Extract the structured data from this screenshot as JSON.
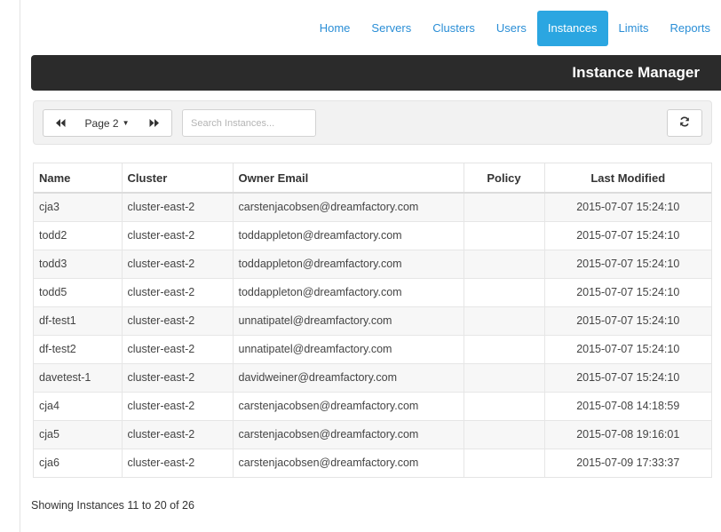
{
  "nav": {
    "items": [
      {
        "label": "Home",
        "active": false
      },
      {
        "label": "Servers",
        "active": false
      },
      {
        "label": "Clusters",
        "active": false
      },
      {
        "label": "Users",
        "active": false
      },
      {
        "label": "Instances",
        "active": true
      },
      {
        "label": "Limits",
        "active": false
      },
      {
        "label": "Reports",
        "active": false
      }
    ]
  },
  "header": {
    "title": "Instance Manager"
  },
  "toolbar": {
    "prev_icon": "fast-backward-icon",
    "page_label": "Page 2",
    "next_icon": "fast-forward-icon",
    "search_placeholder": "Search Instances...",
    "refresh_icon": "refresh-icon"
  },
  "table": {
    "columns": [
      "Name",
      "Cluster",
      "Owner Email",
      "Policy",
      "Last Modified"
    ],
    "rows": [
      [
        "cja3",
        "cluster-east-2",
        "carstenjacobsen@dreamfactory.com",
        "",
        "2015-07-07 15:24:10"
      ],
      [
        "todd2",
        "cluster-east-2",
        "toddappleton@dreamfactory.com",
        "",
        "2015-07-07 15:24:10"
      ],
      [
        "todd3",
        "cluster-east-2",
        "toddappleton@dreamfactory.com",
        "",
        "2015-07-07 15:24:10"
      ],
      [
        "todd5",
        "cluster-east-2",
        "toddappleton@dreamfactory.com",
        "",
        "2015-07-07 15:24:10"
      ],
      [
        "df-test1",
        "cluster-east-2",
        "unnatipatel@dreamfactory.com",
        "",
        "2015-07-07 15:24:10"
      ],
      [
        "df-test2",
        "cluster-east-2",
        "unnatipatel@dreamfactory.com",
        "",
        "2015-07-07 15:24:10"
      ],
      [
        "davetest-1",
        "cluster-east-2",
        "davidweiner@dreamfactory.com",
        "",
        "2015-07-07 15:24:10"
      ],
      [
        "cja4",
        "cluster-east-2",
        "carstenjacobsen@dreamfactory.com",
        "",
        "2015-07-08 14:18:59"
      ],
      [
        "cja5",
        "cluster-east-2",
        "carstenjacobsen@dreamfactory.com",
        "",
        "2015-07-08 19:16:01"
      ],
      [
        "cja6",
        "cluster-east-2",
        "carstenjacobsen@dreamfactory.com",
        "",
        "2015-07-09 17:33:37"
      ]
    ]
  },
  "footer": {
    "summary": "Showing Instances 11 to 20 of 26"
  },
  "colors": {
    "accent": "#2ba6e1",
    "link": "#2a8ed6",
    "header_bg": "#2b2b2b"
  }
}
